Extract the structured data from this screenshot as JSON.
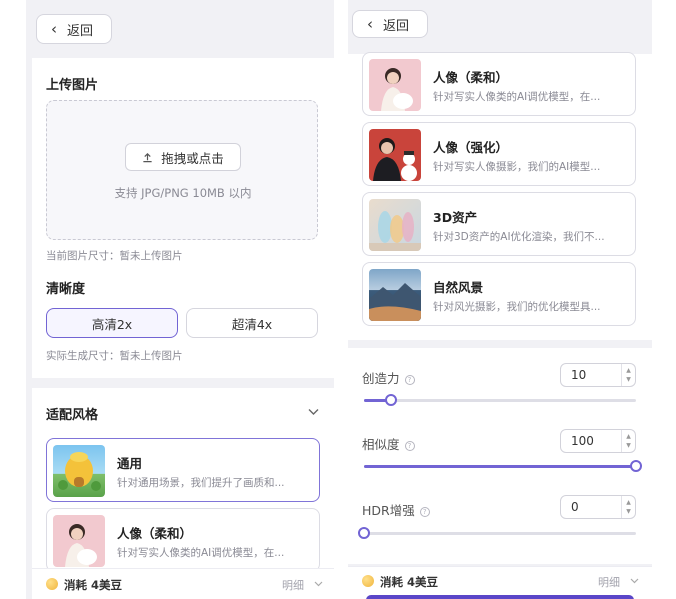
{
  "colors": {
    "accent": "#7264d4",
    "background": "#f1f1f5",
    "card": "#ffffff"
  },
  "left_panel": {
    "back_label": "返回",
    "upload": {
      "title": "上传图片",
      "button_label": "拖拽或点击",
      "support_text": "支持 JPG/PNG 10MB 以内",
      "current_size_text": "当前图片尺寸：暂未上传图片"
    },
    "clarity": {
      "title": "清晰度",
      "options": [
        {
          "label": "高清2x",
          "selected": true
        },
        {
          "label": "超清4x",
          "selected": false
        }
      ],
      "actual_size_text": "实际生成尺寸：暂未上传图片"
    },
    "style_section": {
      "title": "适配风格",
      "items": [
        {
          "name": "通用",
          "desc": "针对通用场景，我们提升了画质和...",
          "selected": true
        },
        {
          "name": "人像（柔和）",
          "desc": "针对写实人像类的AI调优模型，在..."
        }
      ]
    },
    "footer": {
      "cost_text": "消耗 4美豆",
      "detail_label": "明细"
    }
  },
  "right_panel": {
    "back_label": "返回",
    "styles": [
      {
        "name": "人像（柔和）",
        "desc": "针对写实人像类的AI调优模型，在..."
      },
      {
        "name": "人像（强化）",
        "desc": "针对写实人像摄影，我们的AI模型..."
      },
      {
        "name": "3D资产",
        "desc": "针对3D资产的AI优化渲染，我们不..."
      },
      {
        "name": "自然风景",
        "desc": "针对风光摄影，我们的优化模型具..."
      }
    ],
    "sliders": [
      {
        "label": "创造力",
        "value": "10",
        "fraction": 0.1
      },
      {
        "label": "相似度",
        "value": "100",
        "fraction": 1.0
      },
      {
        "label": "HDR增强",
        "value": "0",
        "fraction": 0.0
      }
    ],
    "footer": {
      "cost_text": "消耗 4美豆",
      "detail_label": "明细"
    }
  }
}
